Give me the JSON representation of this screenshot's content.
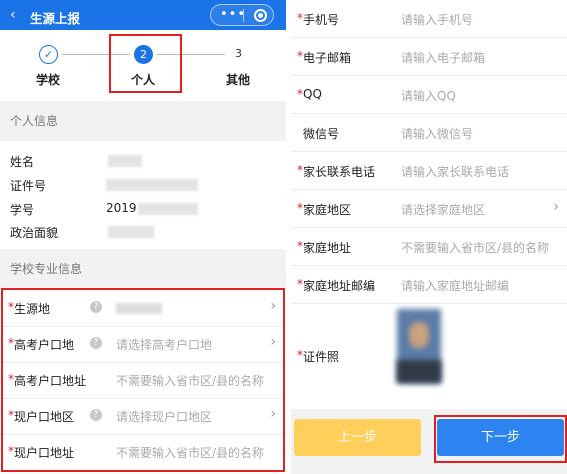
{
  "header": {
    "title": "生源上报",
    "back_icon": "chevron-left-icon",
    "more_icon": "more-icon",
    "target_icon": "target-icon"
  },
  "stepper": {
    "steps": [
      {
        "number": "✓",
        "label": "学校",
        "state": "done"
      },
      {
        "number": "2",
        "label": "个人",
        "state": "active"
      },
      {
        "number": "3",
        "label": "其他",
        "state": "todo"
      }
    ]
  },
  "personal": {
    "title": "个人信息",
    "fields": [
      {
        "label": "姓名"
      },
      {
        "label": "证件号"
      },
      {
        "label": "学号",
        "value": "2019"
      },
      {
        "label": "政治面貌"
      }
    ]
  },
  "school": {
    "title": "学校专业信息",
    "rows": [
      {
        "label": "生源地",
        "required": "*",
        "placeholder": ""
      },
      {
        "label": "高考户口地",
        "required": "*",
        "placeholder": "请选择高考户口地"
      },
      {
        "label": "高考户口地址",
        "required": "*",
        "placeholder": "不需要输入省市区/县的名称"
      },
      {
        "label": "现户口地区",
        "required": "*",
        "placeholder": "请选择现户口地区"
      },
      {
        "label": "现户口地址",
        "required": "*",
        "placeholder": "不需要输入省市区/县的名称"
      }
    ]
  },
  "contact": {
    "rows": [
      {
        "label": "手机号",
        "required": "*",
        "placeholder": "请输入手机号"
      },
      {
        "label": "电子邮箱",
        "required": "*",
        "placeholder": "请输入电子邮箱"
      },
      {
        "label": "QQ",
        "required": "*",
        "placeholder": "请输入QQ"
      },
      {
        "label": "微信号",
        "required": "",
        "placeholder": "请输入微信号"
      },
      {
        "label": "家长联系电话",
        "required": "*",
        "placeholder": "请输入家长联系电话"
      },
      {
        "label": "家庭地区",
        "required": "*",
        "placeholder": "请选择家庭地区"
      },
      {
        "label": "家庭地址",
        "required": "*",
        "placeholder": "不需要输入省市区/县的名称"
      },
      {
        "label": "家庭地址邮编",
        "required": "*",
        "placeholder": "请输入家庭地址邮编"
      },
      {
        "label": "证件照",
        "required": "*"
      }
    ]
  },
  "buttons": {
    "prev": "上一步",
    "next": "下一步"
  },
  "colors": {
    "primary": "#1b73e8",
    "highlight": "#e02020",
    "prev_button": "#ffcf5c",
    "next_button": "#2d84f0"
  }
}
